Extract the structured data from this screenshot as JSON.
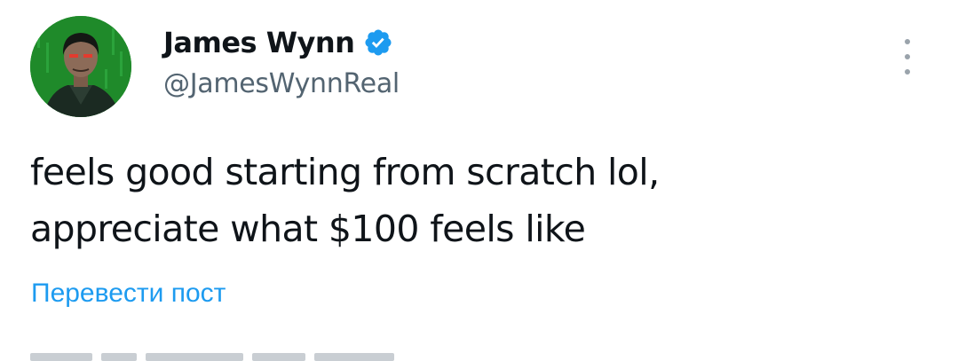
{
  "tweet": {
    "author": {
      "display_name": "James Wynn",
      "handle": "@JamesWynnReal",
      "verified_icon": "verified-badge-icon",
      "avatar_icon": "avatar-image"
    },
    "text_lines": [
      "feels good starting from scratch lol,",
      "appreciate what $100 feels like"
    ],
    "translate_label": "Перевести пост",
    "more_icon": "more-options-icon"
  },
  "colors": {
    "text": "#0f1419",
    "secondary_text": "#536471",
    "link": "#1d9bf0",
    "verified": "#1d9bf0",
    "avatar_background": "#1f8a2a"
  }
}
